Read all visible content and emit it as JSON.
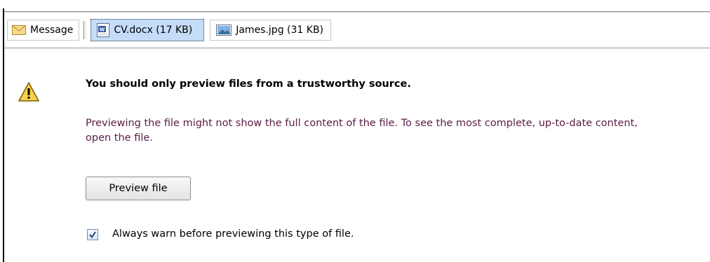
{
  "tabs": {
    "message": {
      "label": "Message",
      "icon": "envelope-icon"
    },
    "attachments": [
      {
        "label": "CV.docx (17 KB)",
        "icon": "word-document-icon",
        "selected": true
      },
      {
        "label": "James.jpg (31 KB)",
        "icon": "image-file-icon",
        "selected": false
      }
    ]
  },
  "warning": {
    "icon": "warning-icon",
    "heading": "You should only preview files from a trustworthy source.",
    "description": "Previewing the file might not show the full content of the file. To see the most complete, up-to-date content, open the file."
  },
  "preview_button": {
    "label": "Preview file"
  },
  "always_warn": {
    "label": "Always warn before previewing this type of file.",
    "checked": true
  },
  "colors": {
    "selected_tab": "#c4dcf7",
    "description_text": "#5a1a45"
  }
}
